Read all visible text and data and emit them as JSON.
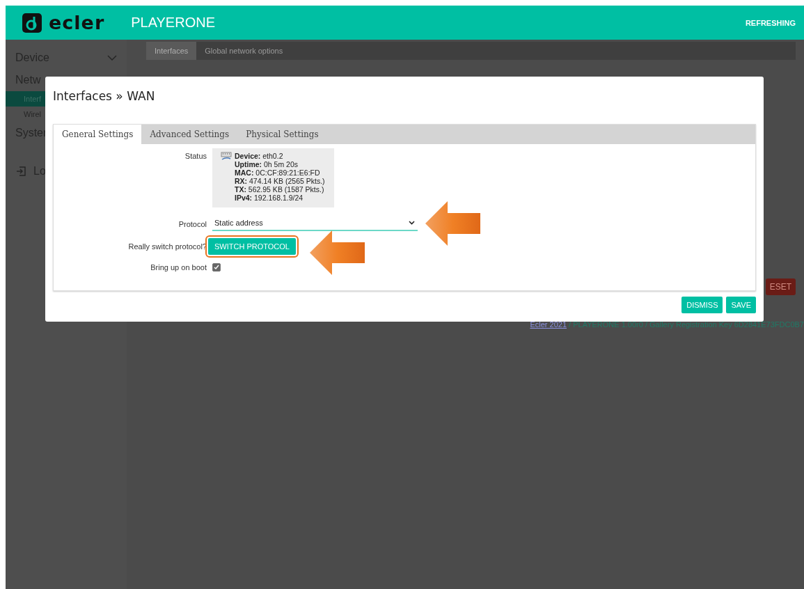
{
  "header": {
    "brand": "ecler",
    "title": "PLAYERONE",
    "status": "REFRESHING"
  },
  "sidebar": {
    "items": [
      {
        "label": "Device",
        "kind": "section",
        "selected": false
      },
      {
        "label": "Netw",
        "kind": "section",
        "selected": false
      },
      {
        "label": "Interf",
        "kind": "sub",
        "selected": true
      },
      {
        "label": "Wirel",
        "kind": "sub",
        "selected": false
      },
      {
        "label": "Syster",
        "kind": "section",
        "selected": false
      }
    ],
    "logout": "Lo"
  },
  "page_tabs": [
    {
      "label": "Interfaces",
      "selected": true
    },
    {
      "label": "Global network options",
      "selected": false
    }
  ],
  "reset_button": "ESET",
  "footer": {
    "link": "Ecler 2021",
    "text": " / PLAYERONE 1.00r0 / Gallery Registration Key 6D2841E73FDC0B7"
  },
  "modal": {
    "title": "Interfaces » WAN",
    "tabs": [
      {
        "label": "General Settings",
        "selected": true
      },
      {
        "label": "Advanced Settings",
        "selected": false
      },
      {
        "label": "Physical Settings",
        "selected": false
      }
    ],
    "status": {
      "label": "Status",
      "lines": [
        "**Device:** eth0.2",
        "**Uptime:** 0h 5m 20s",
        "**MAC:** 0C:CF:89:21:E6:FD",
        "**RX:** 474.14 KB (2565 Pkts.)",
        "**TX:** 562.95 KB (1587 Pkts.)",
        "**IPv4:** 192.168.1.9/24"
      ]
    },
    "protocol": {
      "label": "Protocol",
      "value": "Static address"
    },
    "switch": {
      "label": "Really switch protocol?",
      "button": "SWITCH PROTOCOL"
    },
    "boot": {
      "label": "Bring up on boot",
      "checked": true
    },
    "buttons": [
      "DISMISS",
      "SAVE"
    ]
  }
}
